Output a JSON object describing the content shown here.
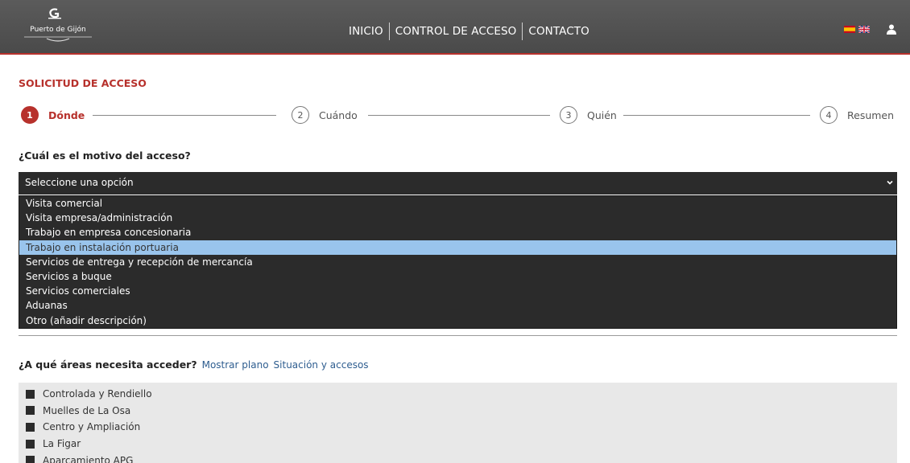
{
  "header": {
    "logo_text": "Puerto de Gijón",
    "nav": [
      "INICIO",
      "CONTROL DE ACCESO",
      "CONTACTO"
    ],
    "colors": {
      "bar": "#4f4f4f",
      "accent": "#b7312c"
    },
    "icons": [
      "spain-flag-icon",
      "uk-flag-icon",
      "user-icon"
    ]
  },
  "form": {
    "title": "SOLICITUD DE ACCESO",
    "steps": [
      {
        "number": "1",
        "label": "Dónde",
        "active": true
      },
      {
        "number": "2",
        "label": "Cuándo",
        "active": false
      },
      {
        "number": "3",
        "label": "Quién",
        "active": false
      },
      {
        "number": "4",
        "label": "Resumen",
        "active": false
      }
    ],
    "question": "¿Cuál es el motivo del acceso?",
    "select_value": "Seleccione una opción",
    "options": [
      "Visita comercial",
      "Visita empresa/administración",
      "Trabajo en empresa concesionaria",
      "Trabajo en instalación portuaria",
      "Servicios de entrega y recepción de mercancía",
      "Servicios a buque",
      "Servicios comerciales",
      "Aduanas",
      "Otro (añadir descripción)"
    ],
    "highlighted_option": "Trabajo en instalación portuaria",
    "areas_question": "¿A qué áreas necesita acceder?",
    "links": [
      "Mostrar plano",
      "Situación y accesos"
    ],
    "areas": [
      "Controlada y Rendiello",
      "Muelles de La Osa",
      "Centro y Ampliación",
      "La Figar",
      "Aparcamiento APG"
    ]
  }
}
